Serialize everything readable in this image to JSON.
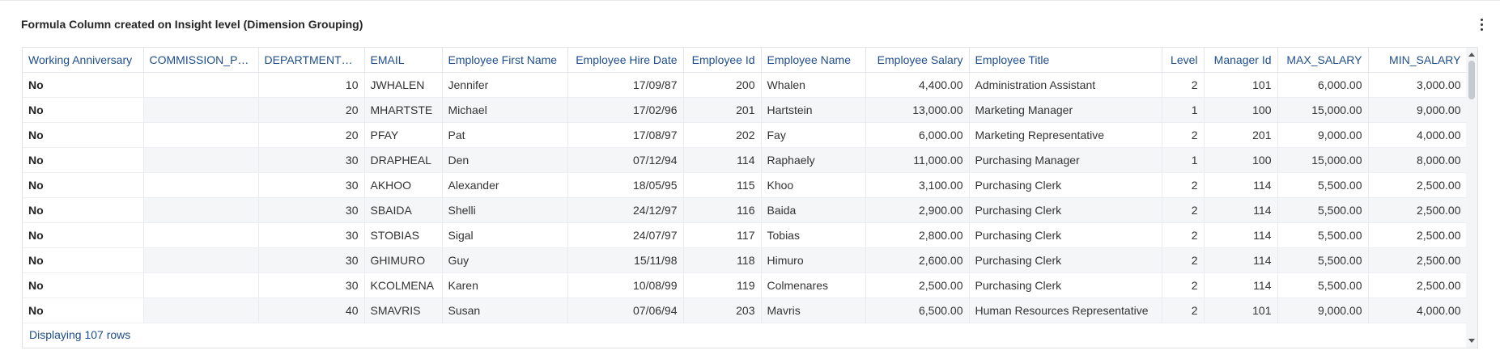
{
  "panel": {
    "title": "Formula Column created on Insight level (Dimension Grouping)",
    "menu_icon": "more-vertical-icon"
  },
  "table": {
    "columns": [
      "Working Anniversary",
      "COMMISSION_PCT",
      "DEPARTMENT_ID",
      "EMAIL",
      "Employee First Name",
      "Employee Hire Date",
      "Employee Id",
      "Employee Name",
      "Employee Salary",
      "Employee Title",
      "Level",
      "Manager Id",
      "MAX_SALARY",
      "MIN_SALARY"
    ],
    "rows": [
      [
        "No",
        "",
        "10",
        "JWHALEN",
        "Jennifer",
        "17/09/87",
        "200",
        "Whalen",
        "4,400.00",
        "Administration Assistant",
        "2",
        "101",
        "6,000.00",
        "3,000.00"
      ],
      [
        "No",
        "",
        "20",
        "MHARTSTE",
        "Michael",
        "17/02/96",
        "201",
        "Hartstein",
        "13,000.00",
        "Marketing Manager",
        "1",
        "100",
        "15,000.00",
        "9,000.00"
      ],
      [
        "No",
        "",
        "20",
        "PFAY",
        "Pat",
        "17/08/97",
        "202",
        "Fay",
        "6,000.00",
        "Marketing Representative",
        "2",
        "201",
        "9,000.00",
        "4,000.00"
      ],
      [
        "No",
        "",
        "30",
        "DRAPHEAL",
        "Den",
        "07/12/94",
        "114",
        "Raphaely",
        "11,000.00",
        "Purchasing Manager",
        "1",
        "100",
        "15,000.00",
        "8,000.00"
      ],
      [
        "No",
        "",
        "30",
        "AKHOO",
        "Alexander",
        "18/05/95",
        "115",
        "Khoo",
        "3,100.00",
        "Purchasing Clerk",
        "2",
        "114",
        "5,500.00",
        "2,500.00"
      ],
      [
        "No",
        "",
        "30",
        "SBAIDA",
        "Shelli",
        "24/12/97",
        "116",
        "Baida",
        "2,900.00",
        "Purchasing Clerk",
        "2",
        "114",
        "5,500.00",
        "2,500.00"
      ],
      [
        "No",
        "",
        "30",
        "STOBIAS",
        "Sigal",
        "24/07/97",
        "117",
        "Tobias",
        "2,800.00",
        "Purchasing Clerk",
        "2",
        "114",
        "5,500.00",
        "2,500.00"
      ],
      [
        "No",
        "",
        "30",
        "GHIMURO",
        "Guy",
        "15/11/98",
        "118",
        "Himuro",
        "2,600.00",
        "Purchasing Clerk",
        "2",
        "114",
        "5,500.00",
        "2,500.00"
      ],
      [
        "No",
        "",
        "30",
        "KCOLMENA",
        "Karen",
        "10/08/99",
        "119",
        "Colmenares",
        "2,500.00",
        "Purchasing Clerk",
        "2",
        "114",
        "5,500.00",
        "2,500.00"
      ],
      [
        "No",
        "",
        "40",
        "SMAVRIS",
        "Susan",
        "07/06/94",
        "203",
        "Mavris",
        "6,500.00",
        "Human Resources Representative",
        "2",
        "101",
        "9,000.00",
        "4,000.00"
      ]
    ],
    "footer": "Displaying 107 rows"
  }
}
